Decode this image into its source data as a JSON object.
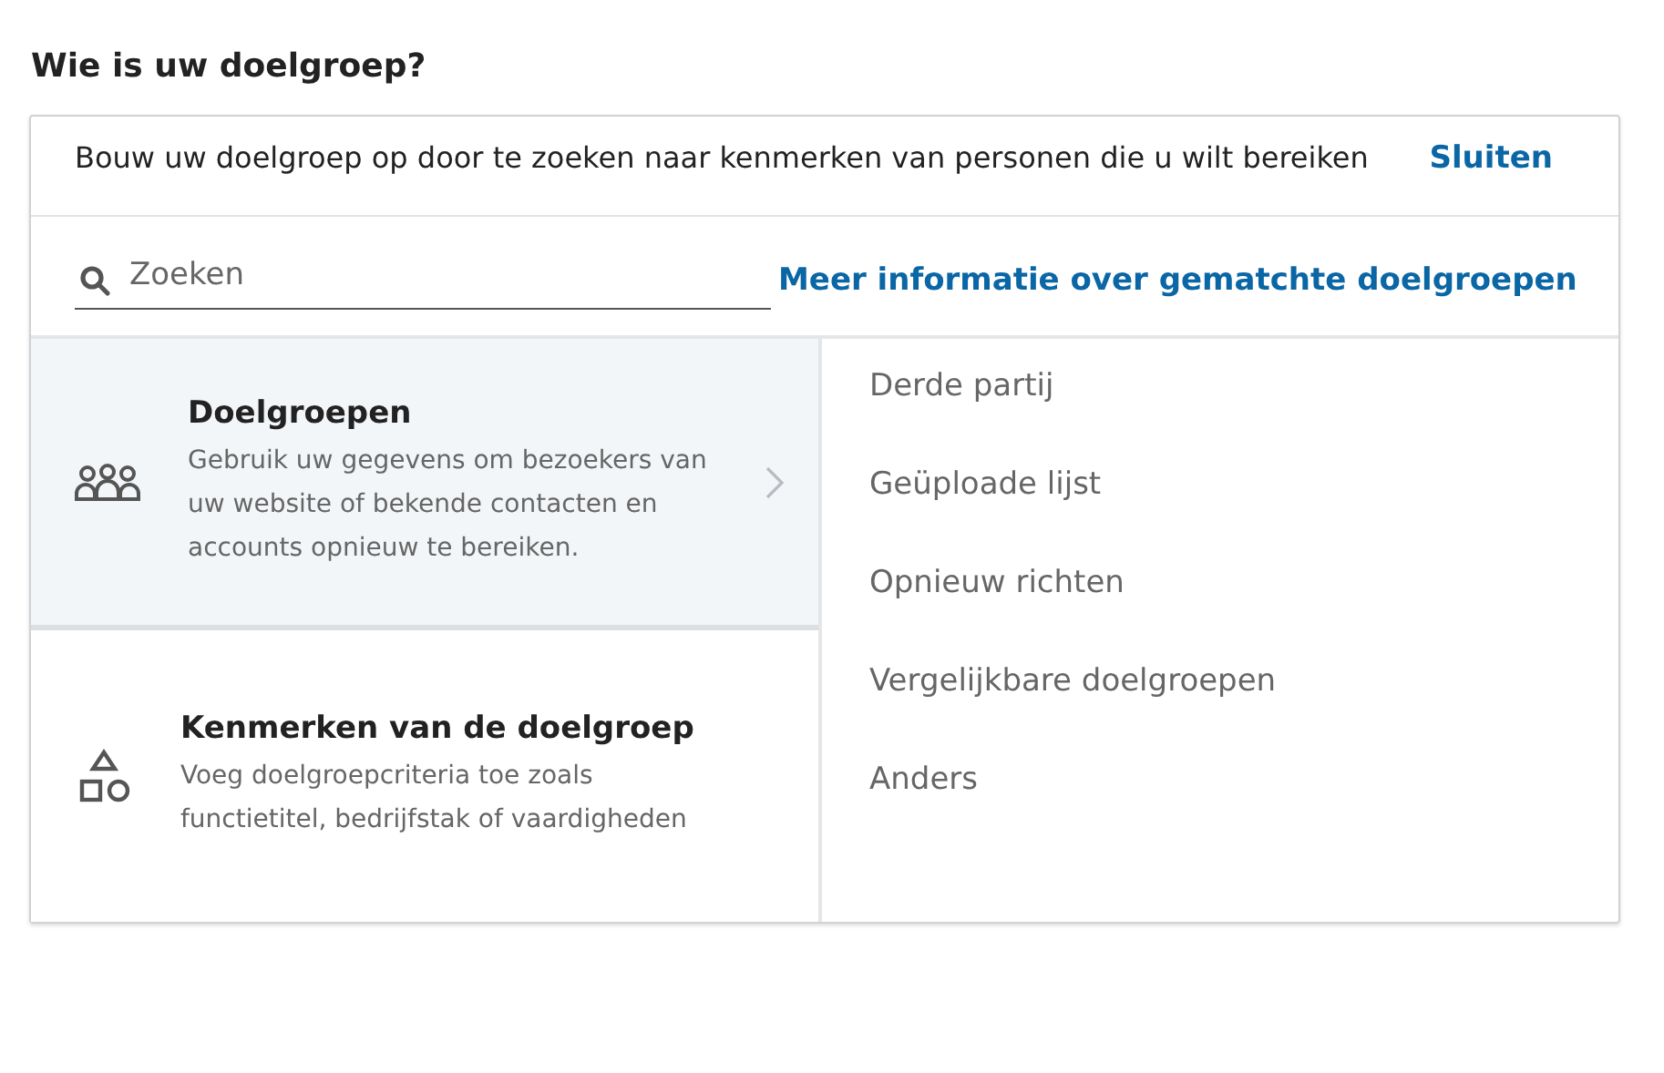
{
  "title": "Wie is uw doelgroep?",
  "intro": {
    "text": "Bouw uw doelgroep op door te zoeken naar kenmerken van personen die u wilt bereiken",
    "close_link": "Sluiten"
  },
  "search": {
    "placeholder": "Zoeken"
  },
  "info_link": "Meer informatie over gematchte doelgroepen",
  "categories": [
    {
      "kind": "people",
      "title": "Doelgroepen",
      "description": "Gebruik uw gegevens om bezoekers van uw website of bekende contacten en accounts opnieuw te bereiken.",
      "selected": true
    },
    {
      "kind": "shapes",
      "title": "Kenmerken van de doelgroep",
      "description": "Voeg doelgroepcriteria toe zoals functietitel, bedrijfstak of vaardigheden",
      "selected": false
    }
  ],
  "options": [
    "Derde partij",
    "Geüploade lijst",
    "Opnieuw richten",
    "Vergelijkbare doelgroepen",
    "Anders"
  ]
}
